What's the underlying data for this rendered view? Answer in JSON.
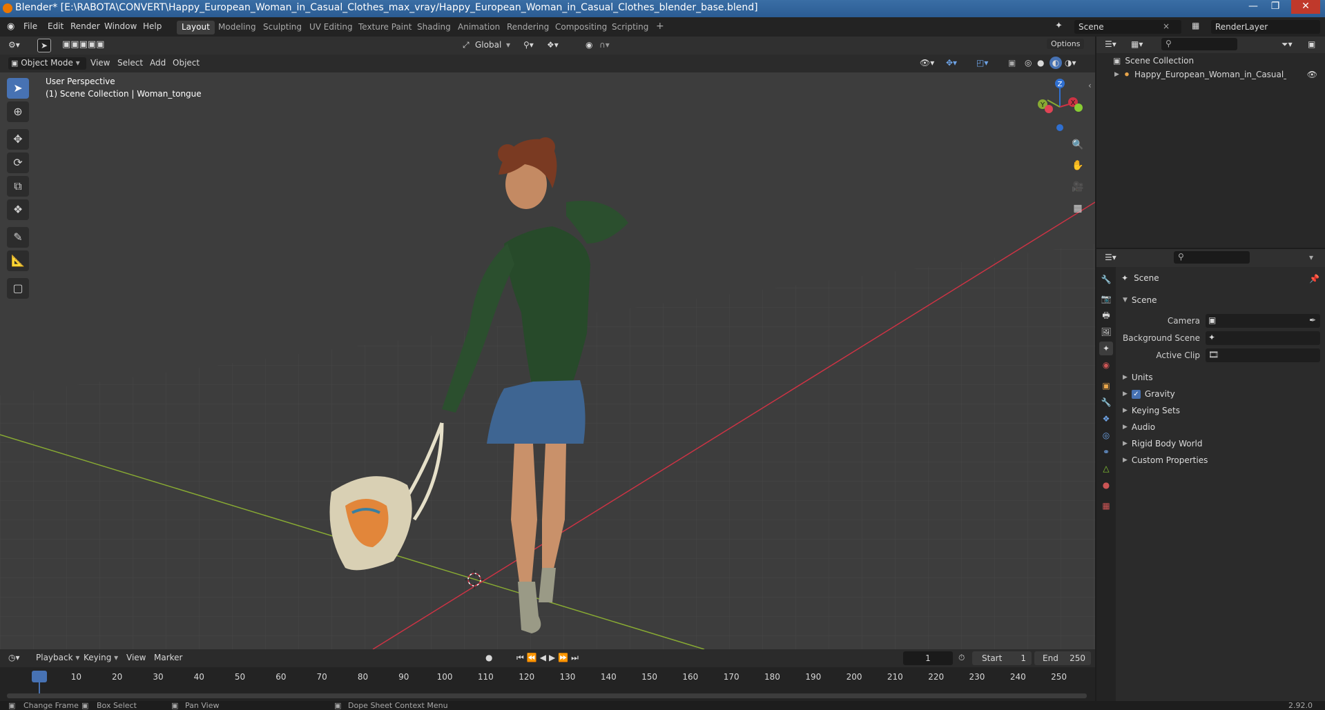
{
  "window": {
    "title": "Blender* [E:\\RABOTA\\CONVERT\\Happy_European_Woman_in_Casual_Clothes_max_vray/Happy_European_Woman_in_Casual_Clothes_blender_base.blend]"
  },
  "menubar": {
    "menus": [
      "File",
      "Edit",
      "Render",
      "Window",
      "Help"
    ],
    "workspaces": [
      "Layout",
      "Modeling",
      "Sculpting",
      "UV Editing",
      "Texture Paint",
      "Shading",
      "Animation",
      "Rendering",
      "Compositing",
      "Scripting"
    ],
    "active_workspace": "Layout",
    "add_tab": "+",
    "scene": "Scene",
    "view_layer": "RenderLayer"
  },
  "viewport": {
    "mode": "Object Mode",
    "menus": [
      "View",
      "Select",
      "Add",
      "Object"
    ],
    "transform_orientation": "Global",
    "options_label": "Options",
    "overlay_line1": "User Perspective",
    "overlay_line2": "(1) Scene Collection | Woman_tongue",
    "gizmo_axes": [
      "Z",
      "Y",
      "X"
    ],
    "tools": [
      "select-box",
      "cursor",
      "move",
      "rotate",
      "scale",
      "transform",
      "annotate",
      "measure",
      "add-cube"
    ],
    "nav_controls": [
      "zoom-icon",
      "hand-icon",
      "camera-icon",
      "grid-icon"
    ]
  },
  "outliner": {
    "root": "Scene Collection",
    "items": [
      {
        "label": "Happy_European_Woman_in_Casual_Clothes",
        "visible": true
      }
    ]
  },
  "properties": {
    "context": "Scene",
    "section": "Scene",
    "fields": [
      {
        "label": "Camera",
        "value": ""
      },
      {
        "label": "Background Scene",
        "value": ""
      },
      {
        "label": "Active Clip",
        "value": ""
      }
    ],
    "panels": [
      {
        "label": "Units",
        "checkbox": false
      },
      {
        "label": "Gravity",
        "checkbox": true,
        "checked": true
      },
      {
        "label": "Keying Sets",
        "checkbox": false
      },
      {
        "label": "Audio",
        "checkbox": false
      },
      {
        "label": "Rigid Body World",
        "checkbox": false
      },
      {
        "label": "Custom Properties",
        "checkbox": false
      }
    ]
  },
  "timeline": {
    "menus": [
      "Playback",
      "Keying",
      "View",
      "Marker"
    ],
    "current_frame": "1",
    "start_label": "Start",
    "start": "1",
    "end_label": "End",
    "end": "250",
    "ticks": [
      "1",
      "10",
      "20",
      "30",
      "40",
      "50",
      "60",
      "70",
      "80",
      "90",
      "100",
      "110",
      "120",
      "130",
      "140",
      "150",
      "160",
      "170",
      "180",
      "190",
      "200",
      "210",
      "220",
      "230",
      "240",
      "250"
    ]
  },
  "statusbar": {
    "items": [
      "Change Frame",
      "Box Select",
      "Pan View",
      "Dope Sheet Context Menu"
    ],
    "version": "2.92.0"
  },
  "colors": {
    "accent": "#4772b3",
    "viewport_bg": "#3d3d3d",
    "x_axis": "#cc3344",
    "y_axis": "#88aa33",
    "z_axis": "#2f6fd0"
  }
}
